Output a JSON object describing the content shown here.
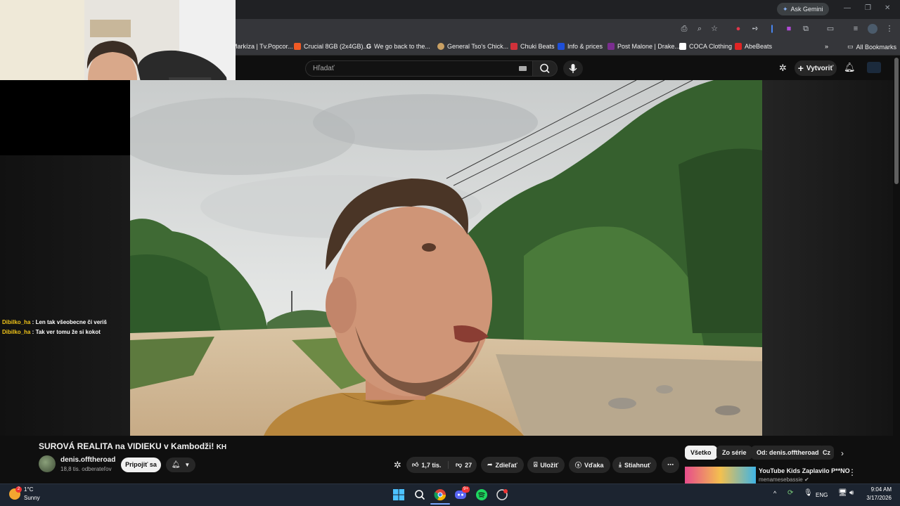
{
  "browser": {
    "ask_gemini": "Ask Gemini",
    "bookmarks": [
      {
        "label": "Markíza | Tv.Popcor...",
        "color": "#ffffff"
      },
      {
        "label": "Crucial 8GB (2x4GB)...",
        "color": "#f05a24"
      },
      {
        "label": "We go back to the...",
        "color": "#4285f4"
      },
      {
        "label": "General Tso's Chick...",
        "color": "#c9a063"
      },
      {
        "label": "Chuki Beats",
        "color": "#d0313a"
      },
      {
        "label": "Info & prices",
        "color": "#1e4fd8"
      },
      {
        "label": "Post Malone | Drake...",
        "color": "#7a2d8f"
      },
      {
        "label": "COCA Clothing",
        "color": "#111111"
      },
      {
        "label": "AbeBeats",
        "color": "#e02424"
      }
    ],
    "all_bookmarks": "All Bookmarks"
  },
  "youtube": {
    "search_placeholder": "Hľadať",
    "create_label": "Vytvoriť",
    "video_title": "SUROVÁ REALITA na VIDIEKU v Kambodži! ",
    "flag_code": "KH",
    "channel_name": "denis.offtheroad",
    "subscribers": "18,8 tis. odberateľov",
    "join_label": "Pripojiť sa",
    "likes": "1,7 tis.",
    "dislikes": "27",
    "share_label": "Zdieľať",
    "save_label": "Uložiť",
    "thanks_label": "Vďaka",
    "download_label": "Stiahnuť",
    "chips": [
      "Všetko",
      "Zo série",
      "Od: denis.offtheroad",
      "Cz"
    ],
    "recommended": {
      "title": "YouTube Kids Zaplavilo P**NO",
      "channel": "menamesebassie"
    }
  },
  "chat": [
    {
      "user": "Dibilko_ha",
      "message": " : Len tak všeobecne či veriš"
    },
    {
      "user": "Dibilko_ha",
      "message": " : Tak ver tomu že si kokot"
    }
  ],
  "taskbar": {
    "weather_temp": "1°C",
    "weather_condition": "Sunny",
    "weather_badge": "2",
    "language": "ENG",
    "time": "9:04 AM",
    "date": "3/17/2026",
    "discord_badge": "9+"
  }
}
